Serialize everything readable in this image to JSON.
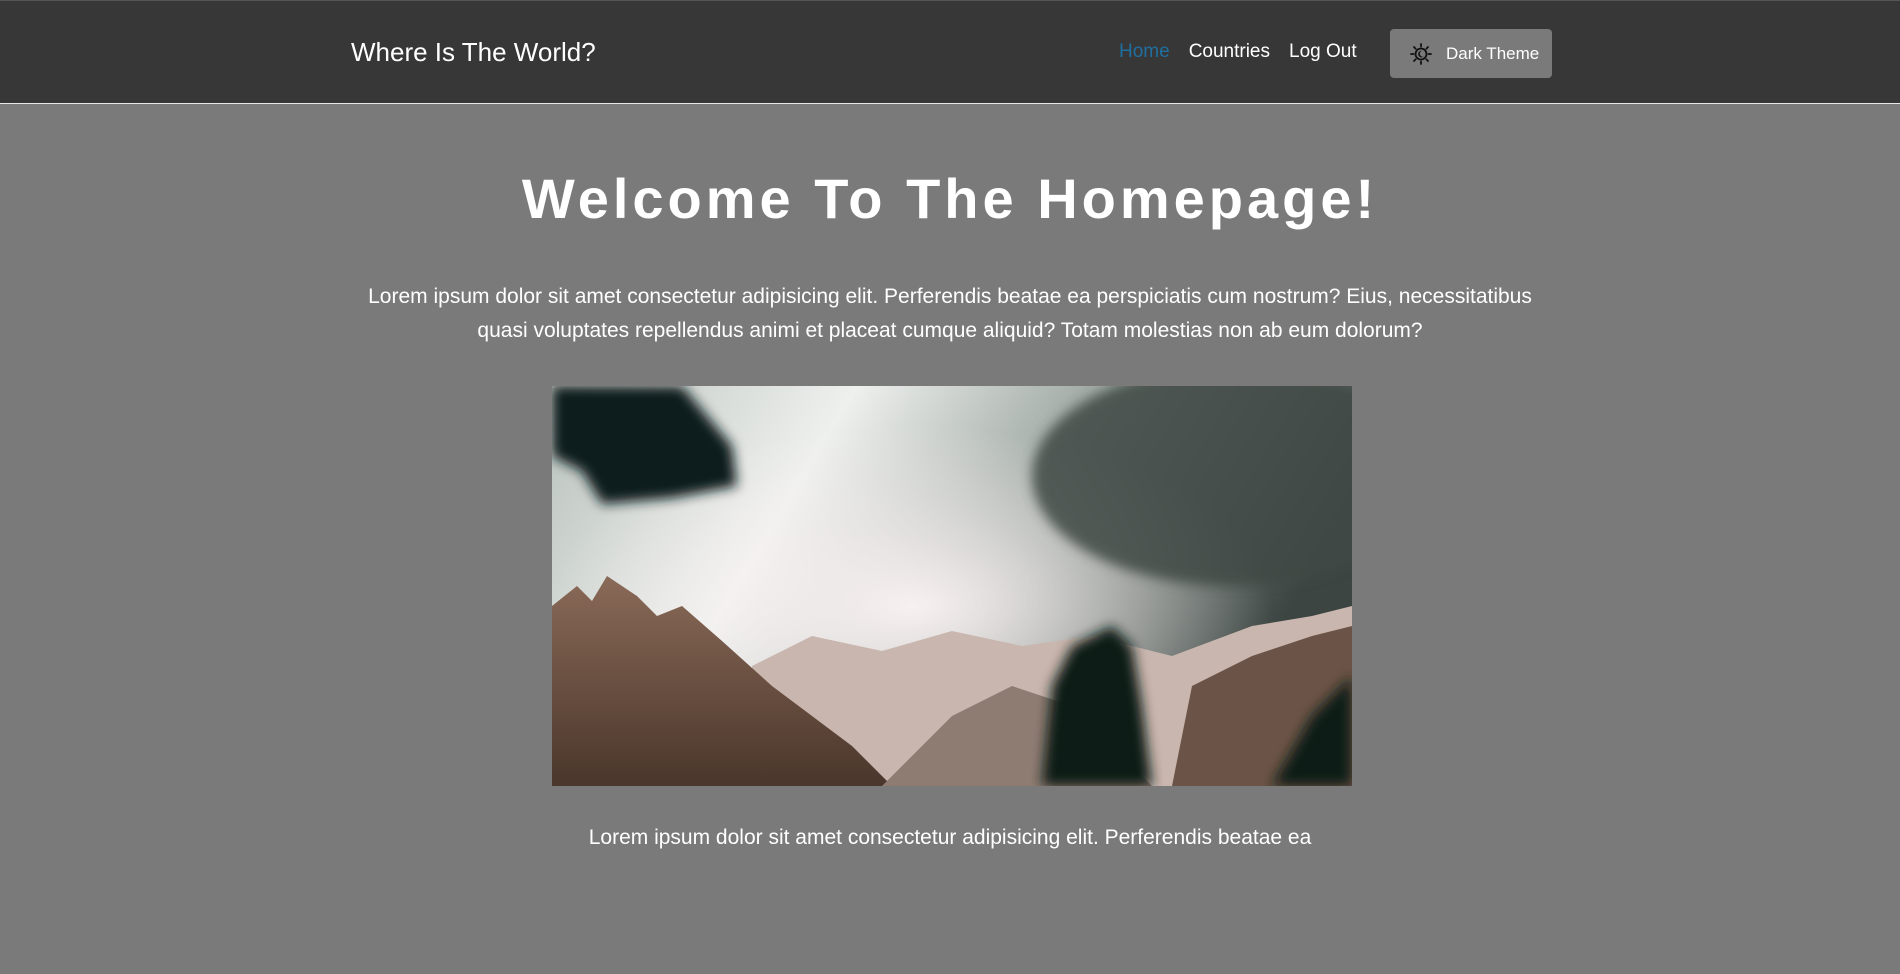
{
  "header": {
    "brand": "Where Is The World?",
    "nav": [
      {
        "label": "Home",
        "active": true
      },
      {
        "label": "Countries",
        "active": false
      },
      {
        "label": "Log Out",
        "active": false
      }
    ],
    "theme_button": {
      "label": "Dark Theme",
      "icon": "sun-moon-icon"
    }
  },
  "main": {
    "title": "Welcome To The Homepage!",
    "intro": "Lorem ipsum dolor sit amet consectetur adipisicing elit. Perferendis beatae ea perspiciatis cum nostrum? Eius, necessitatibus quasi voluptates repellendus animi et placeat cumque aliquid? Totam molestias non ab eum dolorum?",
    "caption": "Lorem ipsum dolor sit amet consectetur adipisicing elit. Perferendis beatae ea"
  },
  "colors": {
    "header_bg": "#373737",
    "page_bg": "#7a7a7a",
    "active_link": "#1f6f9f"
  }
}
